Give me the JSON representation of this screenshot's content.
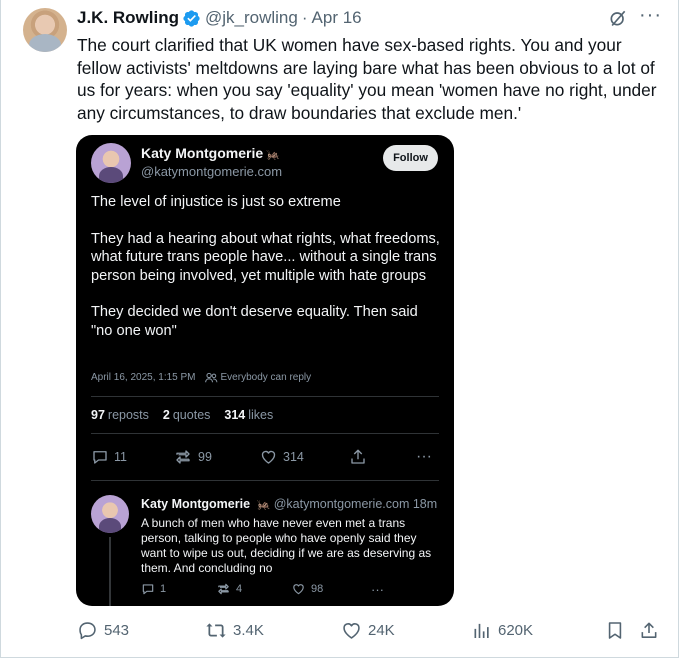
{
  "tweet": {
    "author_name": "J.K. Rowling",
    "handle": "@jk_rowling",
    "separator": "·",
    "date": "Apr 16",
    "text": "The court clarified that UK women have sex-based rights. You and your fellow activists' meltdowns are laying bare what has been obvious to a lot of us for years: when you say 'equality' you mean 'women have no right, under any circumstances, to draw boundaries that exclude men.'",
    "actions": {
      "replies": "543",
      "reposts": "3.4K",
      "likes": "24K",
      "views": "620K"
    }
  },
  "quoted": {
    "author_name": "Katy Montgomerie",
    "emoji": "🦗",
    "handle": "@katymontgomerie.com",
    "follow_label": "Follow",
    "paragraphs": [
      "The level of injustice is just so extreme",
      "They had a hearing about what rights, what freedoms, what future trans people have... without a single trans person being involved, yet multiple with hate groups",
      "They decided we don't deserve equality. Then said \"no one won\""
    ],
    "timestamp": "April 16, 2025, 1:15 PM",
    "reply_setting": "Everybody can reply",
    "stats": {
      "reposts_count": "97",
      "reposts_label": "reposts",
      "quotes_count": "2",
      "quotes_label": "quotes",
      "likes_count": "314",
      "likes_label": "likes"
    },
    "actions": {
      "replies": "11",
      "reposts": "99",
      "likes": "314",
      "more": "···"
    },
    "reply": {
      "author_name": "Katy Montgomerie",
      "emoji": "🦗",
      "handle": "@katymontgomerie.com",
      "age": "18m",
      "text": "A bunch of men who have never even met a trans person, talking to people who have openly said they want to wipe us out, deciding if we are as deserving as them. And concluding no",
      "actions": {
        "replies": "1",
        "reposts": "4",
        "likes": "98",
        "more": "···"
      }
    }
  },
  "ui": {
    "more_label": "···"
  },
  "colors": {
    "verified": "#1d9bf0",
    "secondary_text": "#536471",
    "card_bg": "#000000"
  }
}
